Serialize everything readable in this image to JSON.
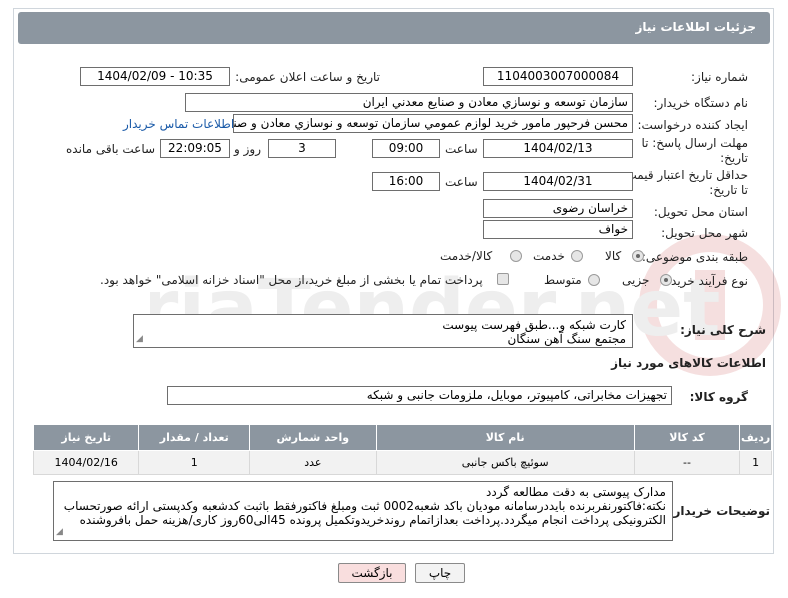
{
  "header": {
    "title": "جزئیات اطلاعات نیاز"
  },
  "fields": {
    "need_number_label": "شماره نیاز:",
    "need_number": "1104003007000084",
    "announce_label": "تاریخ و ساعت اعلان عمومی:",
    "announce_value": "1404/02/09 - 10:35",
    "buyer_org_label": "نام دستگاه خریدار:",
    "buyer_org": "سازمان توسعه و نوسازي معادن و صنايع معدني ايران",
    "requester_label": "ایجاد کننده درخواست:",
    "requester": "محسن فرحپور مامور خريد لوازم عمومي سازمان توسعه و نوسازي معادن و صنايع معدني ايران",
    "contact_link": "اطلاعات تماس خریدار",
    "deadline_label_1": "مهلت ارسال پاسخ: تا",
    "deadline_label_2": "تاریخ:",
    "deadline_date": "1404/02/13",
    "hour_label": "ساعت",
    "deadline_time": "09:00",
    "days_value": "3",
    "day_and_label": "روز و",
    "remaining_time": "22:09:05",
    "remaining_label": "ساعت باقی مانده",
    "min_validity_label_1": "حداقل تاریخ اعتبار قیمت:",
    "min_validity_label_2": "تا تاریخ:",
    "validity_date": "1404/02/31",
    "validity_hour_label": "ساعت",
    "validity_time": "16:00",
    "province_label": "استان محل تحویل:",
    "province": "خراسان رضوی",
    "city_label": "شهر محل تحویل:",
    "city": "خواف",
    "category_label": "طبقه بندی موضوعی:",
    "category_options": [
      "کالا",
      "خدمت",
      "کالا/خدمت"
    ],
    "category_selected": "کالا",
    "process_label": "نوع فرآیند خرید :",
    "process_options": [
      "جزیی",
      "متوسط"
    ],
    "process_selected": "جزیی",
    "payment_note": "پرداخت تمام یا بخشی از مبلغ خرید،از محل \"اسناد خزانه اسلامی\" خواهد بود."
  },
  "description": {
    "label": "شرح کلی نیاز:",
    "line1": "کارت شبکه و...طبق فهرست پیوست",
    "line2": "مجتمع سنگ آهن سنگان"
  },
  "goods_info": {
    "section_title": "اطلاعات کالاهای مورد نیاز",
    "group_label": "گروه کالا:",
    "group_value": "تجهیزات مخابراتی، کامپیوتر، موبایل، ملزومات جانبی و شبکه"
  },
  "table": {
    "columns": [
      "ردیف",
      "کد کالا",
      "نام کالا",
      "واحد شمارش",
      "تعداد / مقدار",
      "تاریخ نیاز"
    ],
    "rows": [
      [
        "1",
        "--",
        "سوئیچ باکس جانبی",
        "عدد",
        "1",
        "1404/02/16"
      ]
    ]
  },
  "buyer_notes": {
    "label": "توضیحات خریدار:",
    "line1": "مدارک پیوستی به دقت مطالعه گردد",
    "line2": "نکته:فاکتورنفربرنده بایددرسامانه مودیان باکد شعبه0002 ثبت ومبلغ فاکتورفقط باثبت کدشعبه وکدپستی ارائه صورتحساب",
    "line3": "الکترونیکی پرداخت انجام میگردد.پرداخت بعدازاتمام روندخریدوتکمیل پرونده 45الی60روز کاری/هزینه حمل بافروشنده"
  },
  "buttons": {
    "print": "چاپ",
    "back": "بازگشت"
  },
  "watermark": {
    "text": "AriaTender.net"
  },
  "colors": {
    "header_bg": "#8c96a0",
    "link": "#1a5aa8",
    "back_bg": "#f9dede"
  }
}
